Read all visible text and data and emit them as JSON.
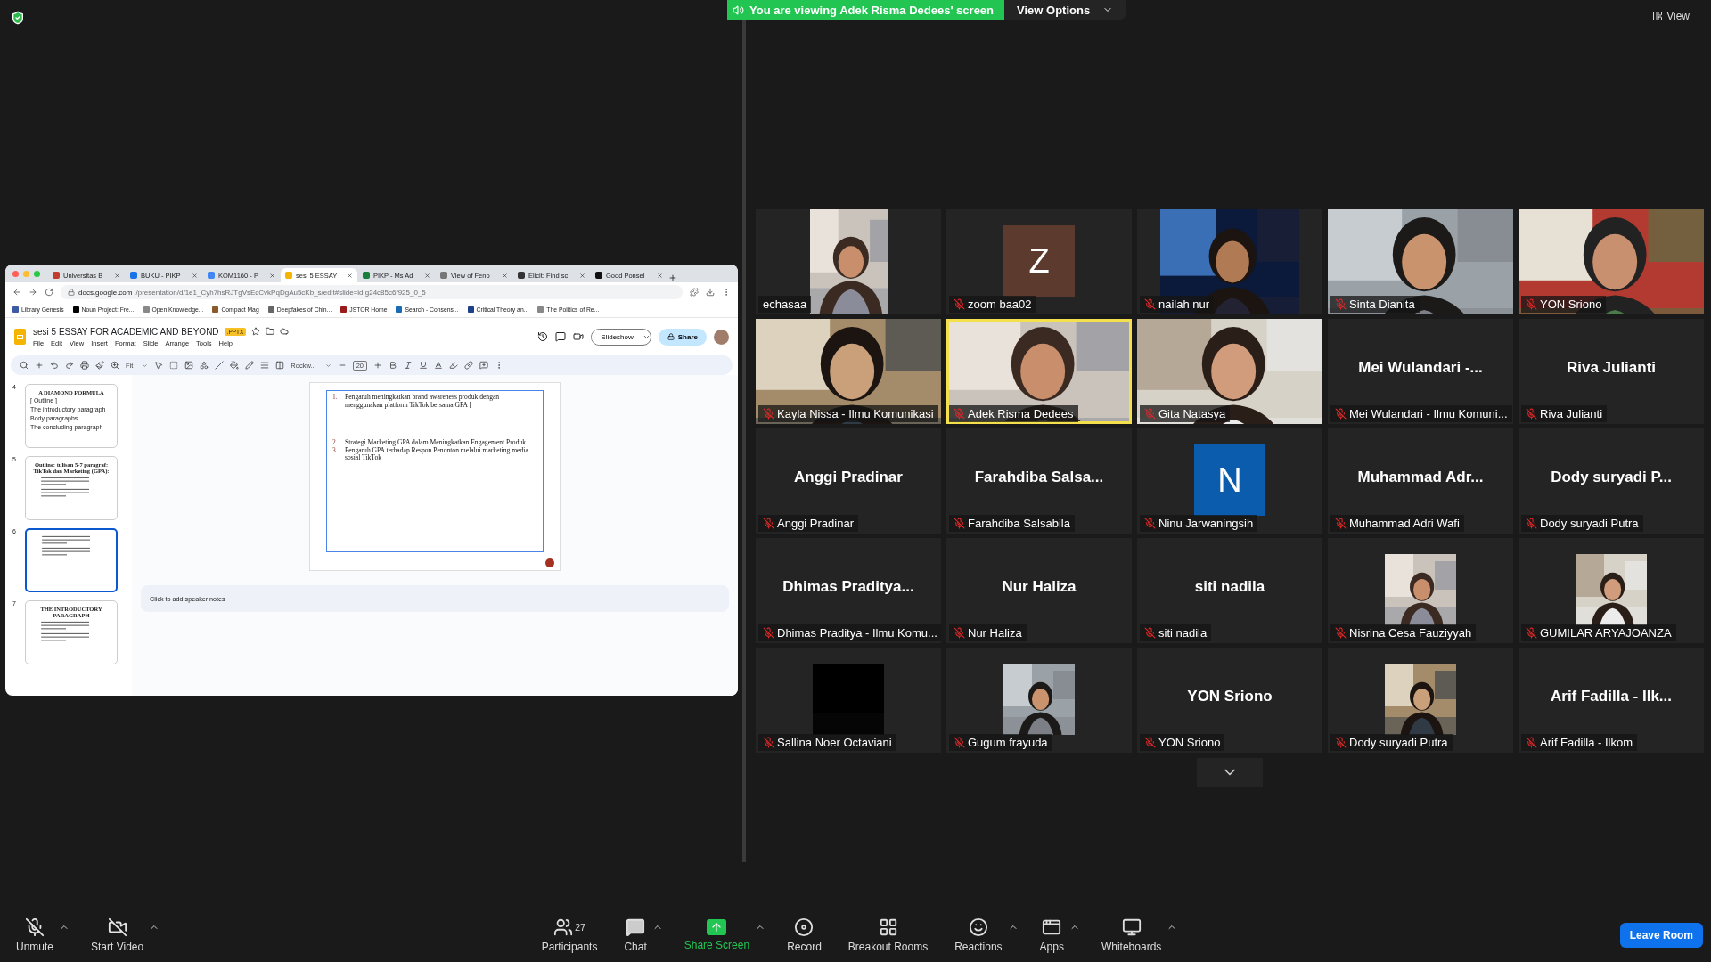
{
  "banner": {
    "text": "You are viewing Adek Risma Dedees' screen",
    "options": "View Options"
  },
  "view_button": "View",
  "shared_screen": {
    "tabs": [
      {
        "label": "Universitas B",
        "selected": false
      },
      {
        "label": "BUKU - PIKP",
        "selected": false
      },
      {
        "label": "KOM1160 - P",
        "selected": false
      },
      {
        "label": "sesi 5 ESSAY",
        "selected": true
      },
      {
        "label": "PIKP - Ms Ad",
        "selected": false
      },
      {
        "label": "View of Feno",
        "selected": false
      },
      {
        "label": "Elicit: Find sc",
        "selected": false
      },
      {
        "label": "Good Ponsel",
        "selected": false
      }
    ],
    "url_host": "docs.google.com",
    "url_path": "/presentation/d/1e1_Cyh7hsRJTgVsEcCvkPqDgAu5cKb_s/edit#slide=id.g24c85c6f925_0_5",
    "bookmarks": [
      "Library Genesis",
      "Noun Project: Fre...",
      "Open Knowledge...",
      "Compact Mag",
      "Deepfakes of Chin...",
      "JSTOR Home",
      "Search - Consens...",
      "Critical Theory an...",
      "The Politics of Re..."
    ],
    "doc_title": "sesi 5 ESSAY FOR ACADEMIC AND BEYOND",
    "file_badge": ".PPTX",
    "menus": [
      "File",
      "Edit",
      "View",
      "Insert",
      "Format",
      "Slide",
      "Arrange",
      "Tools",
      "Help"
    ],
    "slideshow": "Slideshow",
    "share": "Share",
    "zoom": "Fit",
    "font": "Rockw...",
    "font_size": "20",
    "thumbnails": [
      {
        "number": "4",
        "title": "A DIAMOND FORMULA",
        "lines": [
          "[ Outline ]",
          "The introductory paragraph",
          "Body paragraphs",
          "The concluding paragraph"
        ],
        "selected": false
      },
      {
        "number": "5",
        "title": "Outline: tulisan 5-7 paragraf: TikTok dan Marketing (GPA):",
        "selected": false
      },
      {
        "number": "6",
        "selected": true
      },
      {
        "number": "7",
        "title": "THE INTRODUCTORY PARAGRAPH",
        "selected": false
      }
    ],
    "slide_groups": [
      [
        {
          "number": "1.",
          "text": "Pengaruh meningkatkan brand awareness produk dengan menggunakan platform TikTok bersama GPA ["
        }
      ],
      [
        {
          "number": "2.",
          "text": "Strategi Marketing GPA dalam Meningkatkan Engagement Produk"
        },
        {
          "number": "3.",
          "text": "Pengaruh GPA terhadap Respon Penonton melalui marketing media sosial TikTok"
        }
      ]
    ],
    "notes_placeholder": "Click to add speaker notes"
  },
  "tiles": [
    {
      "name": "echasaa",
      "kind": "portrait",
      "muted": false,
      "selected": false
    },
    {
      "name": "zoom baa02",
      "kind": "letter",
      "letter": "Z",
      "color": "#5c3a2d",
      "muted": true,
      "selected": false
    },
    {
      "name": "nailah nur",
      "kind": "wide",
      "muted": true,
      "selected": false
    },
    {
      "name": "Sinta Dianita",
      "kind": "video",
      "muted": true,
      "selected": false
    },
    {
      "name": "YON Sriono",
      "kind": "video",
      "muted": true,
      "selected": false
    },
    {
      "name": "Kayla Nissa - Ilmu Komunikasi",
      "kind": "video",
      "muted": true,
      "selected": false
    },
    {
      "name": "Adek Risma Dedees",
      "kind": "video",
      "muted": true,
      "selected": true
    },
    {
      "name": "Gita Natasya",
      "kind": "video",
      "muted": true,
      "selected": false
    },
    {
      "name": "Mei Wulandari - Ilmu Komuni...",
      "kind": "name",
      "display": "Mei Wulandari -...",
      "muted": true,
      "selected": false
    },
    {
      "name": "Riva Julianti",
      "kind": "name",
      "display": "Riva Julianti",
      "muted": true,
      "selected": false
    },
    {
      "name": "Anggi Pradinar",
      "kind": "name",
      "display": "Anggi Pradinar",
      "muted": true,
      "selected": false
    },
    {
      "name": "Farahdiba Salsabila",
      "kind": "name",
      "display": "Farahdiba Salsa...",
      "muted": true,
      "selected": false
    },
    {
      "name": "Ninu Jarwaningsih",
      "kind": "letter",
      "letter": "N",
      "color": "#0b5cad",
      "muted": true,
      "selected": false
    },
    {
      "name": "Muhammad Adri Wafi",
      "kind": "name",
      "display": "Muhammad Adr...",
      "muted": true,
      "selected": false
    },
    {
      "name": "Dody suryadi Putra",
      "kind": "name",
      "display": "Dody suryadi P...",
      "muted": true,
      "selected": false
    },
    {
      "name": "Dhimas Praditya - Ilmu Komu...",
      "kind": "name",
      "display": "Dhimas  Praditya...",
      "muted": true,
      "selected": false
    },
    {
      "name": "Nur Haliza",
      "kind": "name",
      "display": "Nur Haliza",
      "muted": true,
      "selected": false
    },
    {
      "name": "siti nadila",
      "kind": "name",
      "display": "siti nadila",
      "muted": true,
      "selected": false
    },
    {
      "name": "Nisrina Cesa Fauziyyah",
      "kind": "square",
      "muted": true,
      "selected": false
    },
    {
      "name": "GUMILAR ARYAJOANZA",
      "kind": "square",
      "muted": true,
      "selected": false
    },
    {
      "name": "Sallina Noer Octaviani",
      "kind": "black",
      "muted": true,
      "selected": false
    },
    {
      "name": "Gugum frayuda",
      "kind": "square",
      "muted": true,
      "selected": false
    },
    {
      "name": "YON Sriono",
      "kind": "name",
      "display": "YON Sriono",
      "muted": true,
      "selected": false
    },
    {
      "name": "Dody suryadi Putra",
      "kind": "square",
      "muted": true,
      "selected": false
    },
    {
      "name": "Arif Fadilla - Ilkom",
      "kind": "name",
      "display": "Arif Fadilla - Ilk...",
      "muted": true,
      "selected": false
    }
  ],
  "toolbar": [
    {
      "label": "Unmute",
      "kind": "mic",
      "caret": true
    },
    {
      "label": "Start Video",
      "kind": "video",
      "caret": true
    },
    {
      "label": "Participants",
      "kind": "participants",
      "count": "27",
      "caret": false
    },
    {
      "label": "Chat",
      "kind": "chat",
      "caret": true
    },
    {
      "label": "Share Screen",
      "kind": "share",
      "caret": true
    },
    {
      "label": "Record",
      "kind": "record",
      "caret": false
    },
    {
      "label": "Breakout Rooms",
      "kind": "breakout",
      "caret": false
    },
    {
      "label": "Reactions",
      "kind": "reactions",
      "caret": true
    },
    {
      "label": "Apps",
      "kind": "apps",
      "caret": true
    },
    {
      "label": "Whiteboards",
      "kind": "whiteboards",
      "caret": true
    }
  ],
  "leave": "Leave Room"
}
